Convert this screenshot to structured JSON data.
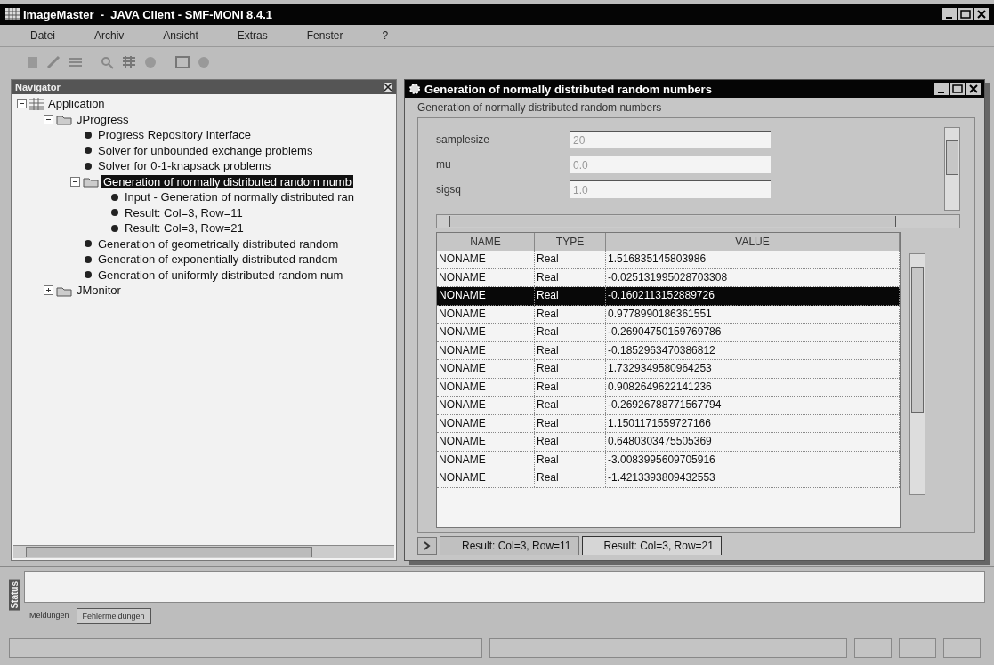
{
  "window": {
    "title": "ImageMaster  -  JAVA Client - SMF-MONI 8.4.1"
  },
  "menu": [
    "Datei",
    "Archiv",
    "Ansicht",
    "Extras",
    "Fenster",
    "?"
  ],
  "navigator": {
    "title": "Navigator",
    "tree": [
      {
        "label": "Application",
        "kind": "root",
        "selected": false,
        "expanded": true,
        "children": [
          {
            "label": "JProgress",
            "kind": "group",
            "selected": false,
            "expanded": true,
            "children": [
              {
                "label": "Progress Repository Interface",
                "kind": "leaf",
                "selected": false
              },
              {
                "label": "Solver for unbounded exchange problems",
                "kind": "leaf",
                "selected": false
              },
              {
                "label": "Solver for 0-1-knapsack problems",
                "kind": "leaf",
                "selected": false
              },
              {
                "label": "Generation of normally distributed random numb",
                "kind": "group",
                "selected": true,
                "expanded": true,
                "children": [
                  {
                    "label": "Input - Generation of normally distributed ran",
                    "kind": "leaf",
                    "selected": false
                  },
                  {
                    "label": "Result: Col=3, Row=11",
                    "kind": "leaf",
                    "selected": false
                  },
                  {
                    "label": "Result: Col=3, Row=21",
                    "kind": "leaf",
                    "selected": false
                  }
                ]
              },
              {
                "label": "Generation of geometrically distributed random",
                "kind": "leaf",
                "selected": false
              },
              {
                "label": "Generation of exponentially distributed random",
                "kind": "leaf",
                "selected": false
              },
              {
                "label": "Generation of uniformly distributed random num",
                "kind": "leaf",
                "selected": false
              }
            ]
          },
          {
            "label": "JMonitor",
            "kind": "group",
            "selected": false,
            "expanded": false
          }
        ]
      }
    ]
  },
  "dialog": {
    "title": "Generation of normally distributed random numbers",
    "group_label": "Generation of normally distributed random numbers",
    "fields": [
      {
        "label": "samplesize",
        "value": "20",
        "disabled": true
      },
      {
        "label": "mu",
        "value": "0.0",
        "disabled": true
      },
      {
        "label": "sigsq",
        "value": "1.0",
        "disabled": true
      }
    ],
    "table": {
      "columns": [
        "NAME",
        "TYPE",
        "VALUE"
      ],
      "rows": [
        {
          "cells": [
            "NONAME",
            "Real",
            "1.516835145803986"
          ],
          "selected": false
        },
        {
          "cells": [
            "NONAME",
            "Real",
            "-0.025131995028703308"
          ],
          "selected": false
        },
        {
          "cells": [
            "NONAME",
            "Real",
            "-0.1602113152889726"
          ],
          "selected": true
        },
        {
          "cells": [
            "NONAME",
            "Real",
            "0.9778990186361551"
          ],
          "selected": false
        },
        {
          "cells": [
            "NONAME",
            "Real",
            "-0.26904750159769786"
          ],
          "selected": false
        },
        {
          "cells": [
            "NONAME",
            "Real",
            "-0.1852963470386812"
          ],
          "selected": false
        },
        {
          "cells": [
            "NONAME",
            "Real",
            "1.7329349580964253"
          ],
          "selected": false
        },
        {
          "cells": [
            "NONAME",
            "Real",
            "0.9082649622141236"
          ],
          "selected": false
        },
        {
          "cells": [
            "NONAME",
            "Real",
            "-0.26926788771567794"
          ],
          "selected": false
        },
        {
          "cells": [
            "NONAME",
            "Real",
            "1.1501171559727166"
          ],
          "selected": false
        },
        {
          "cells": [
            "NONAME",
            "Real",
            "0.6480303475505369"
          ],
          "selected": false
        },
        {
          "cells": [
            "NONAME",
            "Real",
            "-3.0083995609705916"
          ],
          "selected": false
        },
        {
          "cells": [
            "NONAME",
            "Real",
            "-1.4213393809432553"
          ],
          "selected": false
        }
      ]
    },
    "tabs": [
      {
        "label": "Result: Col=3, Row=11",
        "selected": false
      },
      {
        "label": "Result: Col=3, Row=21",
        "selected": true
      }
    ]
  },
  "messages": {
    "title": "Status",
    "tabs": [
      {
        "label": "Meldungen",
        "selected": false
      },
      {
        "label": "Fehlermeldungen",
        "selected": true
      }
    ]
  }
}
